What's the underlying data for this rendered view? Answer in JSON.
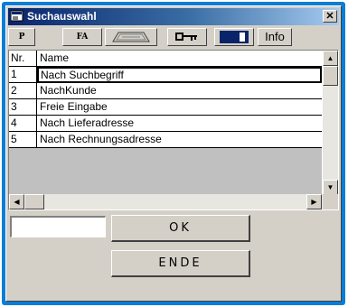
{
  "window": {
    "title": "Suchauswahl",
    "close_label": "✕"
  },
  "toolbar": {
    "p_label": "P",
    "fa_label": "FA",
    "info_label": "Info",
    "keyboard_icon": "keyboard-icon",
    "key_icon": "key-icon",
    "window_icon": "window-icon"
  },
  "grid": {
    "columns": [
      "Nr.",
      "Name"
    ],
    "rows": [
      {
        "nr": "1",
        "name": "Nach Suchbegriff"
      },
      {
        "nr": "2",
        "name": "NachKunde"
      },
      {
        "nr": "3",
        "name": "Freie Eingabe"
      },
      {
        "nr": "4",
        "name": "Nach Lieferadresse"
      },
      {
        "nr": "5",
        "name": "Nach Rechnungsadresse"
      }
    ],
    "selected_row": "1"
  },
  "form": {
    "search_value": "",
    "ok_label": "OK",
    "end_label": "ENDE"
  },
  "colors": {
    "titlebar_start": "#0a246a",
    "titlebar_end": "#a6caf0",
    "face": "#d4d0c8",
    "frame": "#0a7dd6"
  }
}
